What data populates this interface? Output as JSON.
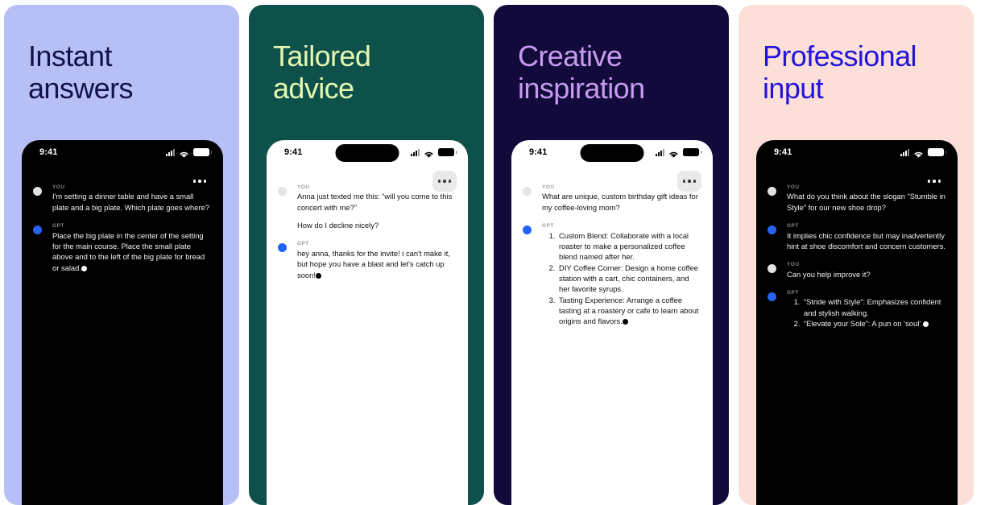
{
  "gallery": {
    "panels": [
      {
        "id": "instant-answers",
        "headline": "Instant\nanswers",
        "bg_color": "#B6C0F7",
        "headline_color": "#13124A",
        "phone_theme": "dark",
        "has_dynamic_island": false,
        "menu_pill": false,
        "status": {
          "time": "9:41",
          "signal_icon": "cellular-bars-icon",
          "wifi_icon": "wifi-icon",
          "battery_icon": "battery-icon"
        },
        "menu_icon": "ellipsis-icon",
        "messages": [
          {
            "role": "YOU",
            "avatar": "you",
            "paragraphs": [
              "I'm setting a dinner table and have a small plate and a big plate. Which plate goes where?"
            ],
            "list": [],
            "cursor": false
          },
          {
            "role": "GPT",
            "avatar": "gpt",
            "paragraphs": [
              "Place the big plate in the center of the setting for the main course. Place the small plate above and to the left of the big plate for bread or salad."
            ],
            "list": [],
            "cursor": true
          }
        ]
      },
      {
        "id": "tailored-advice",
        "headline": "Tailored\nadvice",
        "bg_color": "#0D514A",
        "headline_color": "#E6F7B2",
        "phone_theme": "light",
        "has_dynamic_island": true,
        "menu_pill": true,
        "status": {
          "time": "9:41",
          "signal_icon": "cellular-bars-icon",
          "wifi_icon": "wifi-icon",
          "battery_icon": "battery-icon"
        },
        "menu_icon": "ellipsis-icon",
        "messages": [
          {
            "role": "YOU",
            "avatar": "you",
            "paragraphs": [
              "Anna just texted me this: “will you come to this concert with me?”",
              "How do I decline nicely?"
            ],
            "list": [],
            "cursor": false
          },
          {
            "role": "GPT",
            "avatar": "gpt",
            "paragraphs": [
              "hey anna, thanks for the invite! i can't make it, but hope you have a blast and let's catch up soon!"
            ],
            "list": [],
            "cursor": true
          }
        ]
      },
      {
        "id": "creative-inspiration",
        "headline": "Creative\ninspiration",
        "bg_color": "#120A3A",
        "headline_color": "#C79BF0",
        "phone_theme": "light",
        "has_dynamic_island": true,
        "menu_pill": true,
        "status": {
          "time": "9:41",
          "signal_icon": "cellular-bars-icon",
          "wifi_icon": "wifi-icon",
          "battery_icon": "battery-icon"
        },
        "menu_icon": "ellipsis-icon",
        "messages": [
          {
            "role": "YOU",
            "avatar": "you",
            "paragraphs": [
              "What are unique, custom birthday gift ideas for my coffee-loving mom?"
            ],
            "list": [],
            "cursor": false
          },
          {
            "role": "GPT",
            "avatar": "gpt",
            "paragraphs": [],
            "list": [
              "Custom Blend: Collaborate with a local roaster to make a personalized coffee blend named after her.",
              "DIY Coffee Corner: Design a home coffee station with a cart, chic containers, and her favorite syrups.",
              "Tasting Experience: Arrange a coffee tasting at a roastery or cafe to learn about origins and flavors."
            ],
            "cursor": true
          }
        ]
      },
      {
        "id": "professional-input",
        "headline": "Professional\ninput",
        "bg_color": "#FBDFD8",
        "headline_color": "#2213DD",
        "phone_theme": "dark",
        "has_dynamic_island": false,
        "menu_pill": false,
        "status": {
          "time": "9:41",
          "signal_icon": "cellular-bars-icon",
          "wifi_icon": "wifi-icon",
          "battery_icon": "battery-icon"
        },
        "menu_icon": "ellipsis-icon",
        "messages": [
          {
            "role": "YOU",
            "avatar": "you",
            "paragraphs": [
              "What do you think about the slogan “Stumble in Style” for our new shoe drop?"
            ],
            "list": [],
            "cursor": false
          },
          {
            "role": "GPT",
            "avatar": "gpt",
            "paragraphs": [
              "It implies chic confidence but may inadvertently hint at shoe discomfort and concern customers."
            ],
            "list": [],
            "cursor": false
          },
          {
            "role": "YOU",
            "avatar": "you",
            "paragraphs": [
              "Can you help improve it?"
            ],
            "list": [],
            "cursor": false
          },
          {
            "role": "GPT",
            "avatar": "gpt",
            "paragraphs": [],
            "list": [
              "“Stride with Style”: Emphasizes confident and stylish walking.",
              "“Elevate your Sole”: A pun on ‘soul’."
            ],
            "cursor": true
          }
        ]
      }
    ]
  }
}
